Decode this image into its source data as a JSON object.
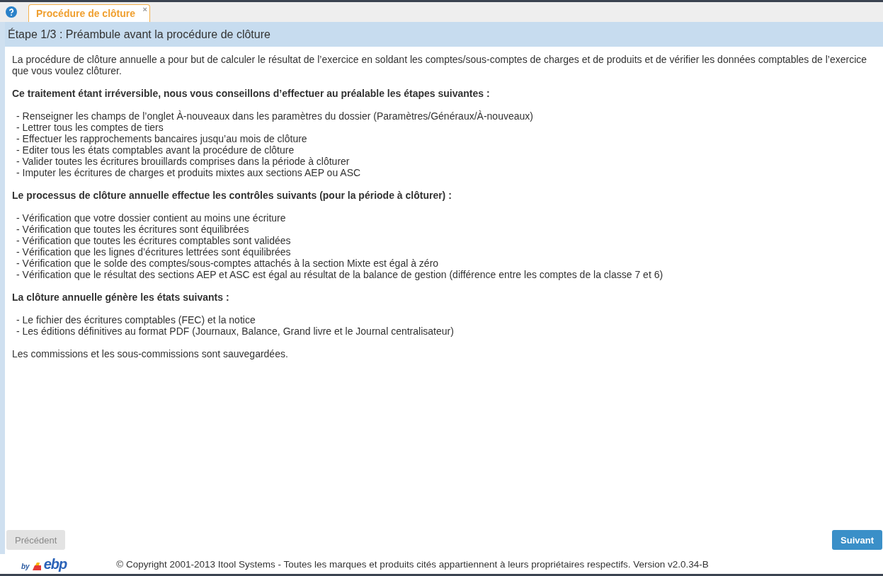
{
  "help_icon": true,
  "tabs": [
    {
      "label": "Procédure de clôture",
      "selected": true,
      "close": "×"
    }
  ],
  "step_title": "Étape 1/3 : Préambule avant la procédure de clôture",
  "content": [
    {
      "kind": "paragraph",
      "text": "La procédure de clôture annuelle a pour but de calculer le résultat de l’exercice en soldant les comptes/sous-comptes de charges et de produits et de vérifier les données comptables de l’exercice que vous voulez clôturer."
    },
    {
      "kind": "heading",
      "text": "Ce traitement étant irréversible, nous vous conseillons d’effectuer au préalable les étapes suivantes :"
    },
    {
      "kind": "list",
      "items": [
        "- Renseigner les champs de l’onglet À-nouveaux dans les paramètres du dossier (Paramètres/Généraux/À-nouveaux)",
        "- Lettrer tous les comptes de tiers",
        "- Effectuer les rapprochements bancaires jusqu’au mois de clôture",
        "- Editer tous les états comptables avant la procédure de clôture",
        "- Valider toutes les écritures brouillards comprises dans la période à clôturer",
        "- Imputer les écritures de charges et produits mixtes aux sections AEP ou ASC"
      ]
    },
    {
      "kind": "heading",
      "text": "Le processus de clôture annuelle effectue les contrôles suivants (pour la période à clôturer) :"
    },
    {
      "kind": "list",
      "items": [
        "- Vérification que votre dossier contient au moins une écriture",
        "- Vérification que toutes les écritures sont équilibrées",
        "- Vérification que toutes les écritures comptables sont validées",
        "- Vérification que les lignes d’écritures lettrées sont équilibrées",
        "- Vérification que le solde des comptes/sous-comptes attachés à la section Mixte est égal à zéro",
        "- Vérification que le résultat des sections AEP et ASC est égal au résultat de la balance de gestion (différence entre les comptes de la classe 7 et 6)"
      ]
    },
    {
      "kind": "heading",
      "text": "La clôture annuelle génère les états suivants :"
    },
    {
      "kind": "list",
      "items": [
        "- Le fichier des écritures comptables (FEC) et la notice",
        "- Les éditions définitives au format PDF (Journaux, Balance, Grand livre et le Journal centralisateur)"
      ]
    },
    {
      "kind": "paragraph",
      "text": "Les commissions et les sous-commissions sont sauvegardées."
    }
  ],
  "buttons": [
    {
      "label": "Précédent",
      "disabled": true
    },
    {
      "label": "Suivant",
      "disabled": false
    }
  ],
  "footer": {
    "logo_by": "by",
    "logo_name": "ebp",
    "copyright": "© Copyright 2001-2013 Itool Systems - Toutes les marques et produits cités appartiennent à leurs propriétaires respectifs. Version v2.0.34-B"
  }
}
